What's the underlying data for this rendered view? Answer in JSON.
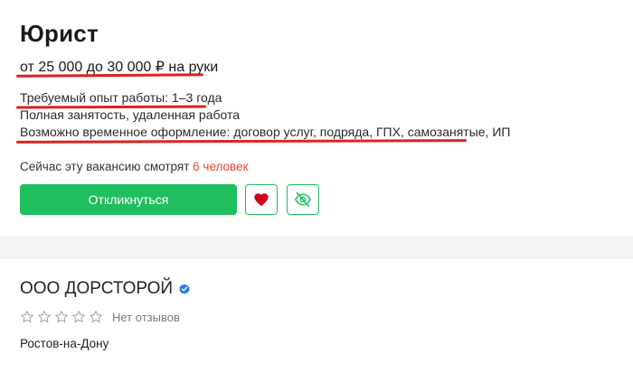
{
  "vacancy": {
    "title": "Юрист",
    "salary": "от 25 000 до 30 000 ₽ на руки",
    "experience": "Требуемый опыт работы: 1–3 года",
    "employment": "Полная занятость, удаленная работа",
    "contract": "Возможно временное оформление: договор услуг, подряда, ГПХ, самозанятые, ИП",
    "viewers_prefix": "Сейчас эту вакансию смотрят",
    "viewers_count": "6 человек",
    "apply_label": "Откликнуться"
  },
  "company": {
    "name": "ООО ДОРСТОРОЙ",
    "reviews": "Нет отзывов",
    "city": "Ростов-на-Дону"
  },
  "icons": {
    "favorite": "heart-icon",
    "hide": "eye-off-icon",
    "verified": "verified-check-icon",
    "stars": "star-outline-icon"
  },
  "colors": {
    "accent": "#1fbf5f",
    "heart": "#d0021b",
    "highlight": "#e6452d",
    "verified": "#2b7de9",
    "annotation": "#e02020"
  }
}
